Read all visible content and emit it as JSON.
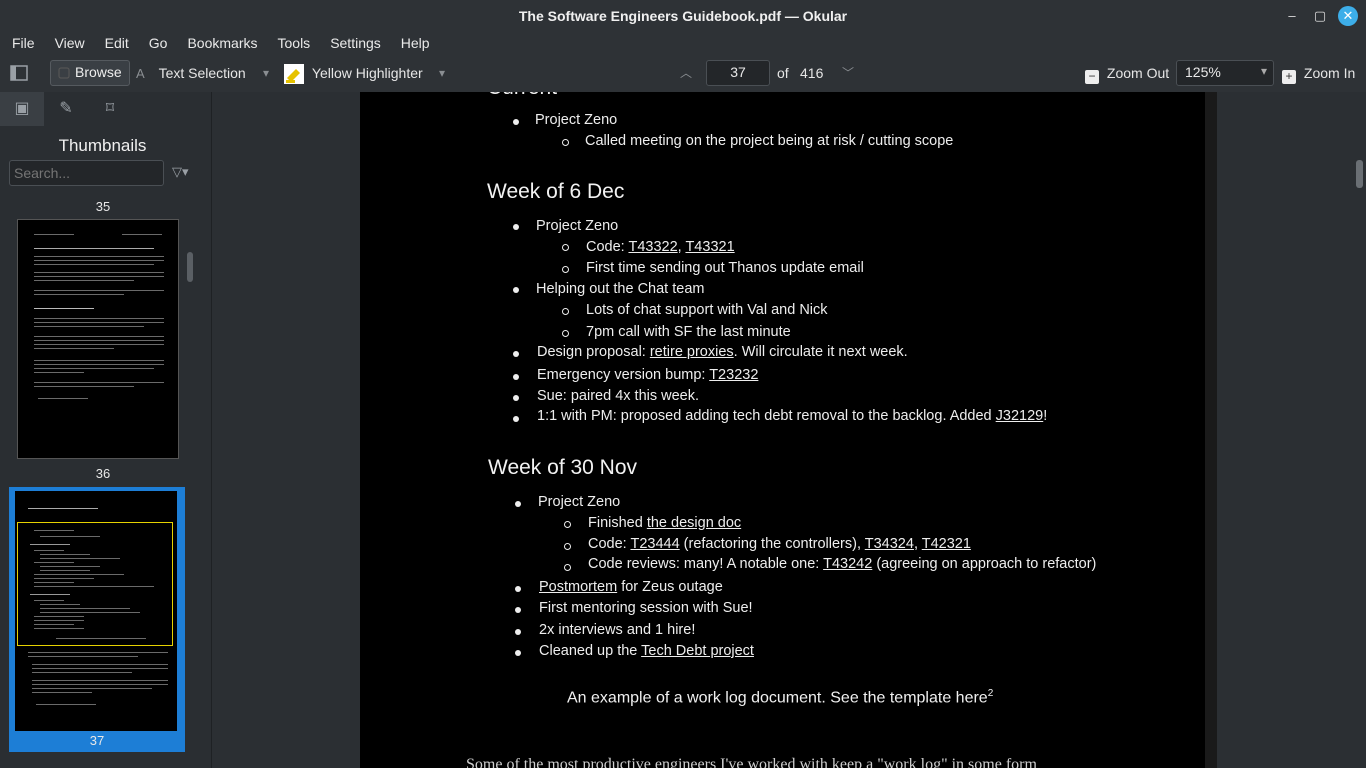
{
  "window": {
    "title": "The Software Engineers Guidebook.pdf — Okular",
    "minimize": "–",
    "maximize": "▢",
    "close": "✕"
  },
  "menu": [
    "File",
    "View",
    "Edit",
    "Go",
    "Bookmarks",
    "Tools",
    "Settings",
    "Help"
  ],
  "toolbar": {
    "browse": "Browse",
    "text_selection": "Text Selection",
    "highlighter": "Yellow Highlighter",
    "page_current": "37",
    "page_of": "of",
    "page_total": "416",
    "zoom_out": "Zoom Out",
    "zoom_level": "125%",
    "zoom_in": "Zoom In"
  },
  "sidebar": {
    "heading": "Thumbnails",
    "search_placeholder": "Search...",
    "page_labels": [
      "35",
      "36",
      "37"
    ],
    "selected_page": "37"
  },
  "document": {
    "top_cut": "Current",
    "block1": {
      "project": "Project Zeno",
      "item": "Called meeting on the project being at risk / cutting scope"
    },
    "week1": {
      "heading": "Week of 6 Dec",
      "project": "Project Zeno",
      "code_prefix": "Code: ",
      "code1": "T43322",
      "code2": "T43321",
      "thanos": "First time sending out Thanos update email",
      "chat": "Helping out the Chat team",
      "chat_support": "Lots of chat support with Val and Nick",
      "sf_call": "7pm call with SF the last minute",
      "design_prefix": "Design proposal: ",
      "design_link": "retire proxies",
      "design_suffix": ". Will circulate it next week.",
      "bump_prefix": "Emergency version bump: ",
      "bump_link": "T23232",
      "sue": "Sue: paired 4x this week.",
      "pm_prefix": "1:1 with PM: proposed adding tech debt removal to the backlog. Added ",
      "pm_link": "J32129",
      "pm_suffix": "!"
    },
    "week2": {
      "heading": "Week of 30 Nov",
      "project": "Project Zeno",
      "finished_prefix": "Finished ",
      "finished_link": "the design doc",
      "code_prefix": "Code: ",
      "code_link1": "T23444",
      "code_mid": " (refactoring the controllers), ",
      "code_link2": "T34324",
      "code_link3": "T42321",
      "reviews_prefix": "Code reviews: many! A notable one: ",
      "reviews_link": "T43242",
      "reviews_suffix": " (agreeing on approach to refactor)",
      "postmortem_link": "Postmortem",
      "postmortem_suffix": " for Zeus outage",
      "mentoring": "First mentoring session with Sue!",
      "interviews": "2x interviews and 1 hire!",
      "cleanup_prefix": "Cleaned up the ",
      "cleanup_link": "Tech Debt project"
    },
    "caption": "An example of a work log document. See the template here",
    "caption_sup": "2",
    "bottom_cut": "Some of the most productive engineers I've worked with keep a \"work log\" in some form"
  }
}
